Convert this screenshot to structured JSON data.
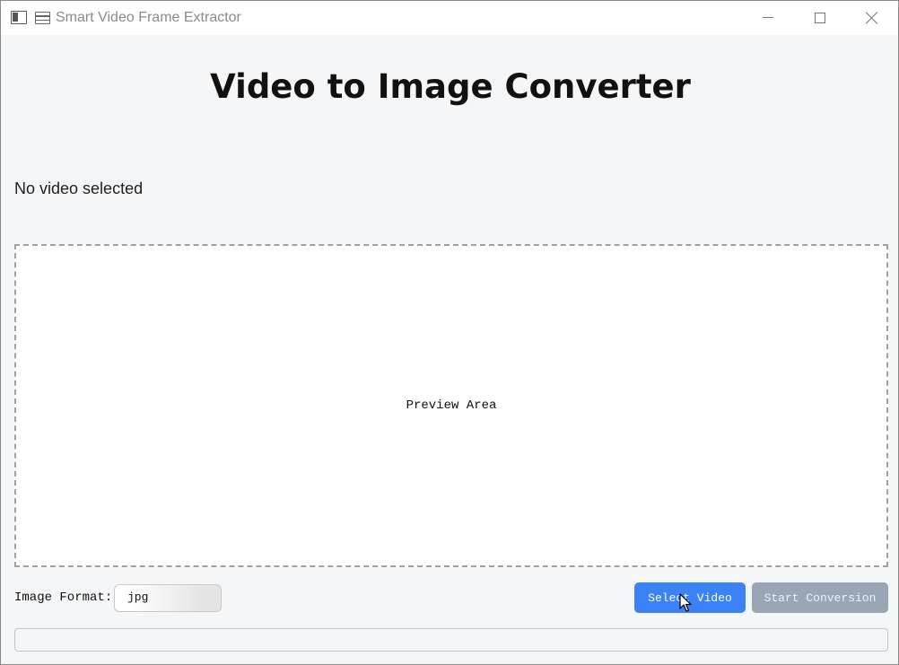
{
  "window": {
    "title": "Smart Video Frame Extractor",
    "controls": [
      "minimize",
      "maximize",
      "close"
    ]
  },
  "main": {
    "heading": "Video to Image Converter",
    "status": "No video selected",
    "preview_text": "Preview Area"
  },
  "controls": {
    "format_label": "Image Format:",
    "format_value": "jpg",
    "select_button": "Select Video",
    "start_button": "Start Conversion"
  },
  "progress": {
    "value": 0
  },
  "colors": {
    "primary_button": "#3b82f6",
    "disabled_button": "#9aa6b4",
    "background": "#f5f6f8"
  }
}
